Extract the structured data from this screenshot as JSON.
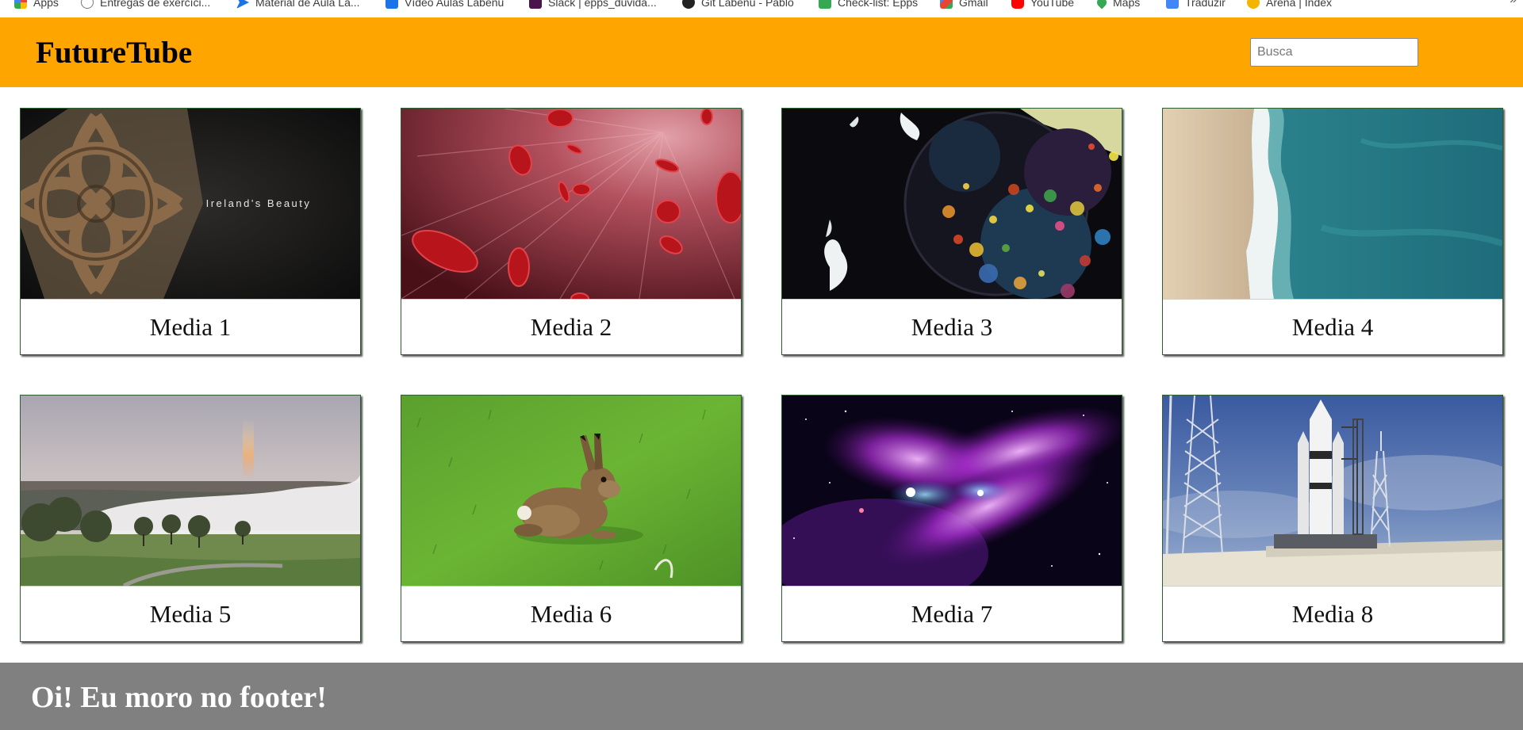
{
  "browser": {
    "bookmarks": [
      {
        "label": "Apps",
        "icon": "apps-grid-icon",
        "color": "#ea4335"
      },
      {
        "label": "Entregas de exercíci...",
        "icon": "info-circle-icon",
        "color": "#777777"
      },
      {
        "label": "Material de Aula La...",
        "icon": "arrow-bookmark-icon",
        "color": "#1a73e8"
      },
      {
        "label": "Vídeo Aulas Labenu",
        "icon": "check-square-icon",
        "color": "#1a73e8"
      },
      {
        "label": "Slack | epps_duvida...",
        "icon": "slack-icon",
        "color": "#4a154b"
      },
      {
        "label": "Git Labenu - Pablo",
        "icon": "github-icon",
        "color": "#222222"
      },
      {
        "label": "Check-list: Epps",
        "icon": "check-square-icon",
        "color": "#34a853"
      },
      {
        "label": "Gmail",
        "icon": "gmail-icon",
        "color": "#ea4335"
      },
      {
        "label": "YouTube",
        "icon": "youtube-icon",
        "color": "#ff0000"
      },
      {
        "label": "Maps",
        "icon": "maps-pin-icon",
        "color": "#34a853"
      },
      {
        "label": "Traduzir",
        "icon": "translate-icon",
        "color": "#4285f4"
      },
      {
        "label": "Arena | Index",
        "icon": "arena-icon",
        "color": "#f4b400"
      }
    ]
  },
  "header": {
    "title": "FutureTube",
    "background": "#ffa500",
    "search": {
      "placeholder": "Busca",
      "value": ""
    }
  },
  "media": [
    {
      "title": "Media 1",
      "thumbnail": "celtic-cross",
      "caption": "Ireland's Beauty"
    },
    {
      "title": "Media 2",
      "thumbnail": "blood-cells"
    },
    {
      "title": "Media 3",
      "thumbnail": "color-bubbles"
    },
    {
      "title": "Media 4",
      "thumbnail": "beach-aerial"
    },
    {
      "title": "Media 5",
      "thumbnail": "foggy-landscape-rainbow"
    },
    {
      "title": "Media 6",
      "thumbnail": "hare-on-grass"
    },
    {
      "title": "Media 7",
      "thumbnail": "purple-nebula"
    },
    {
      "title": "Media 8",
      "thumbnail": "rocket-launch-pad"
    }
  ],
  "footer": {
    "text": "Oi! Eu moro no footer!",
    "background": "#808080"
  }
}
